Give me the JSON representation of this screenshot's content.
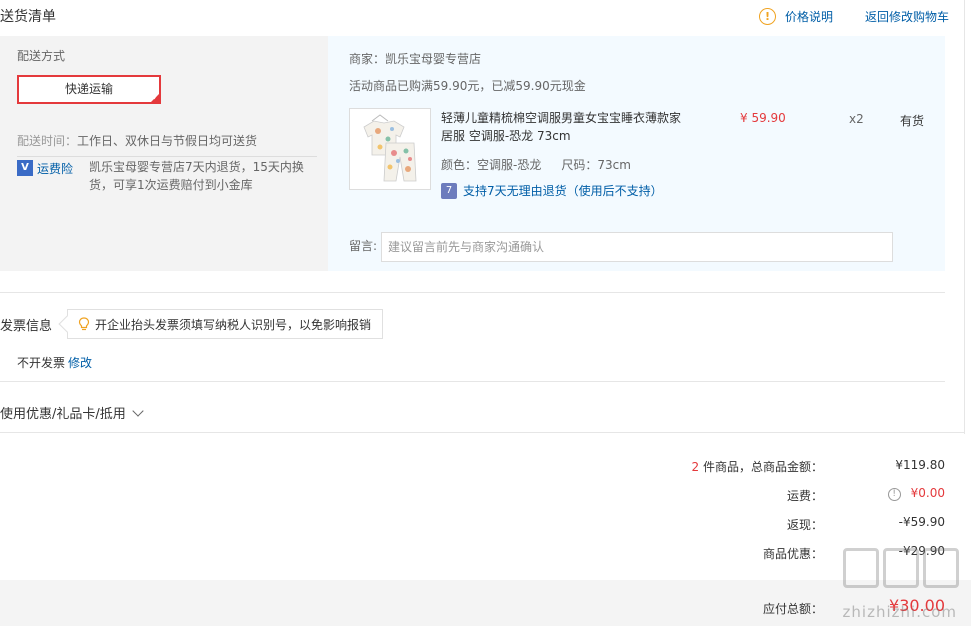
{
  "header": {
    "title": "送货清单",
    "price_explain": "价格说明",
    "back_to_cart": "返回修改购物车",
    "accent": "#e4393c",
    "link_color": "#005ea7"
  },
  "shipping": {
    "method_label": "配送方式",
    "method_selected": "快递运输",
    "delivery_time_label": "配送时间：",
    "delivery_time_value": "工作日、双休日与节假日均可送货",
    "insurance_icon": "V",
    "insurance_label": "运费险",
    "insurance_desc": "凯乐宝母婴专营店7天内退货，15天内换货，可享1次运费赔付到小金库"
  },
  "order": {
    "merchant": "商家：凯乐宝母婴专营店",
    "promo": "活动商品已购满59.90元，已减59.90元现金",
    "product": {
      "title": "轻薄儿童精梳棉空调服男童女宝宝睡衣薄款家居服 空调服-恐龙 73cm",
      "price": "¥ 59.90",
      "qty": "x2",
      "stock": "有货",
      "color": "颜色：空调服-恐龙",
      "size": "尺码：73cm",
      "return_icon": "7",
      "return_policy": "支持7天无理由退货（使用后不支持）"
    },
    "note_label": "留言:",
    "note_placeholder": "建议留言前先与商家沟通确认"
  },
  "invoice": {
    "title": "发票信息",
    "tip": "开企业抬头发票须填写纳税人识别号，以免影响报销",
    "status": "不开发票",
    "modify": "修改"
  },
  "coupon": {
    "title": "使用优惠/礼品卡/抵用"
  },
  "summary": {
    "count": "2",
    "count_label": "件商品，总商品金额：",
    "goods_total": "¥119.80",
    "freight_label": "运费：",
    "freight": "¥0.00",
    "rebate_label": "返现：",
    "rebate": "-¥59.90",
    "discount_label": "商品优惠：",
    "discount": "-¥29.90",
    "total_label": "应付总额：",
    "total": "¥30.00"
  },
  "watermark": "zhizhizhi.com"
}
